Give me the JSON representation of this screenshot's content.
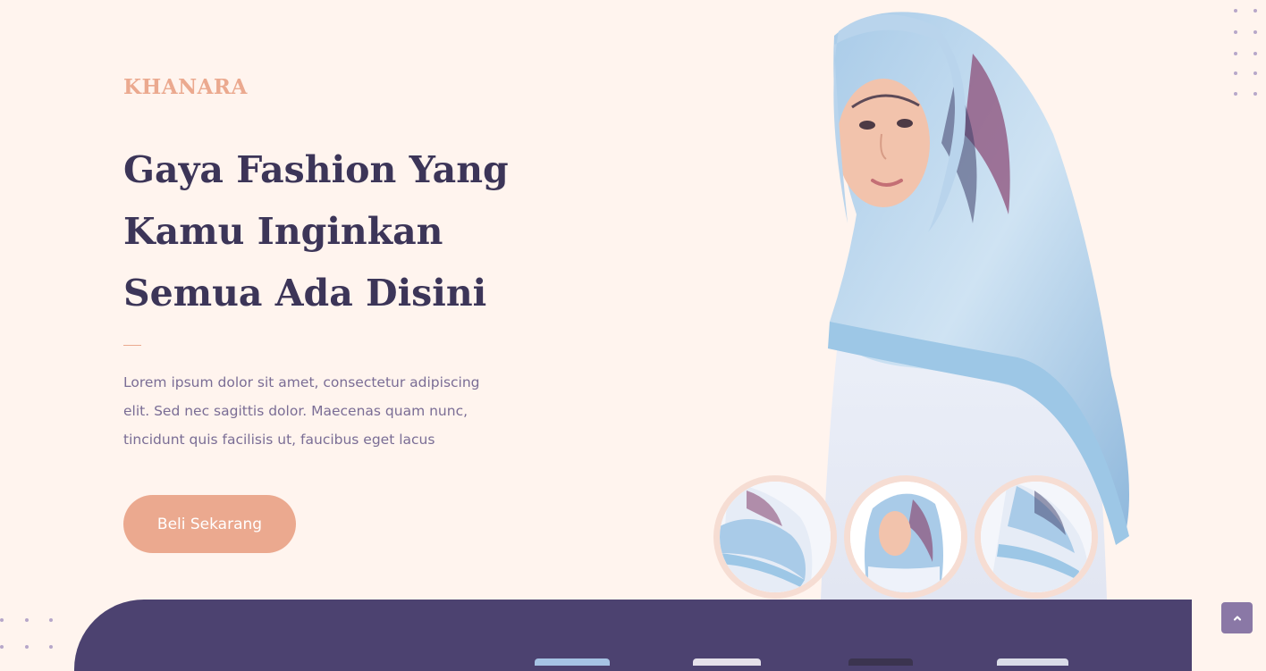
{
  "hero": {
    "brand": "KHANARA",
    "headline_lines": [
      "Gaya Fashion Yang",
      "Kamu Inginkan",
      "Semua Ada Disini"
    ],
    "description": "Lorem ipsum dolor sit amet, consectetur adipiscing elit. Sed nec sagittis dolor. Maecenas quam nunc, tincidunt quis facilisis ut, faucibus eget lacus",
    "cta_label": "Beli Sekarang"
  },
  "colors": {
    "background": "#fff4ee",
    "accent": "#eba98f",
    "heading": "#3c3558",
    "body_text": "#7a6d95",
    "band": "#4c4270",
    "scroll_button": "#8a78a6"
  },
  "gallery": {
    "thumbnails": [
      "thumbnail-scarf-drape",
      "thumbnail-model-portrait",
      "thumbnail-scarf-drape-alt"
    ]
  },
  "icons": {
    "scroll_top": "chevron-up-icon"
  }
}
